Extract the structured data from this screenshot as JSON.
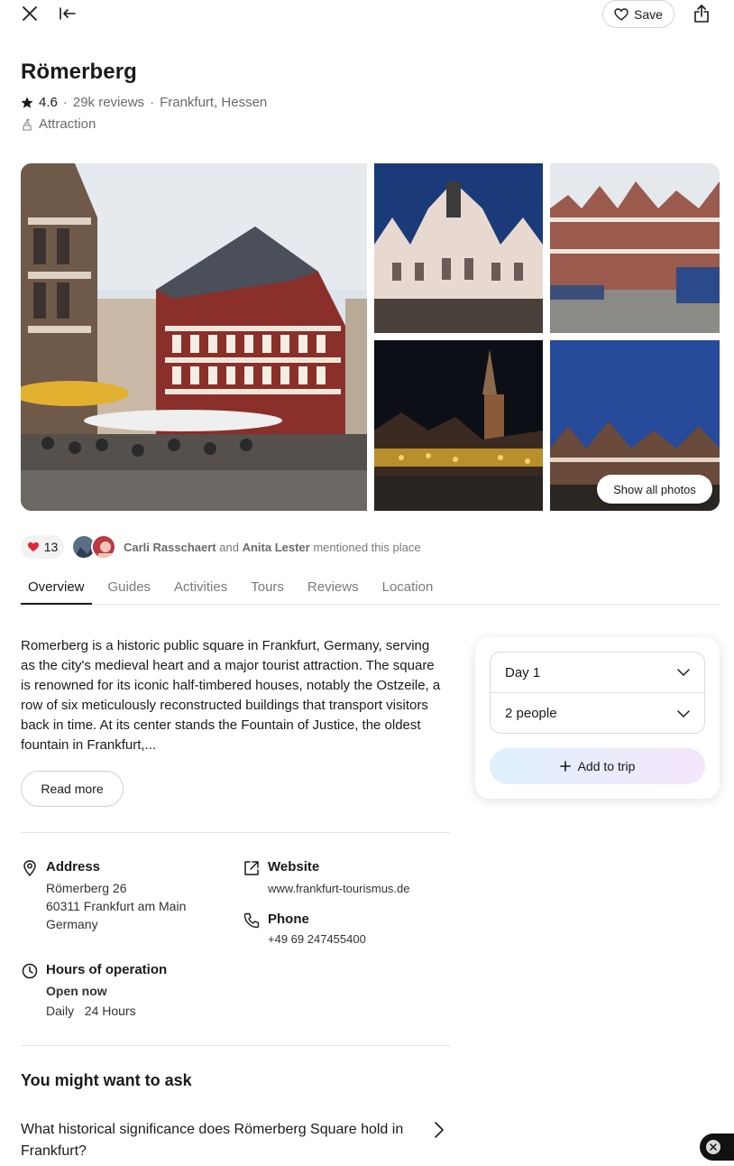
{
  "header": {
    "save_label": "Save"
  },
  "place": {
    "title": "Römerberg",
    "rating": "4.6",
    "reviews": "29k reviews",
    "location": "Frankfurt, Hessen",
    "separator": "·",
    "category": "Attraction"
  },
  "gallery": {
    "show_all_label": "Show all photos"
  },
  "social": {
    "likes": "13",
    "user1": "Carli Rasschaert",
    "and": "and",
    "user2": "Anita Lester",
    "mention_suffix": "mentioned this place"
  },
  "tabs": [
    "Overview",
    "Guides",
    "Activities",
    "Tours",
    "Reviews",
    "Location"
  ],
  "overview": {
    "description": "Romerberg is a historic public square in Frankfurt, Germany, serving as the city's medieval heart and a major tourist attraction. The square is renowned for its iconic half-timbered houses, notably the Ostzeile, a row of six meticulously reconstructed buildings that transport visitors back in time. At its center stands the Fountain of Justice, the oldest fountain in Frankfurt,...",
    "read_more_label": "Read more"
  },
  "info": {
    "address_label": "Address",
    "address_line1": "Römerberg 26",
    "address_line2": "60311 Frankfurt am Main",
    "address_line3": "Germany",
    "website_label": "Website",
    "website_value": "www.frankfurt-tourismus.de",
    "phone_label": "Phone",
    "phone_value": "+49 69 247455400",
    "hours_label": "Hours of operation",
    "open_status": "Open now",
    "hours_day": "Daily",
    "hours_value": "24 Hours"
  },
  "ask": {
    "title": "You might want to ask",
    "question": "What historical significance does Römerberg Square hold in Frankfurt?"
  },
  "trip": {
    "day_value": "Day 1",
    "people_value": "2 people",
    "add_label": "Add to trip"
  },
  "colors": {
    "accent_green": "#2e9e5b",
    "heart_red": "#e0283a"
  }
}
